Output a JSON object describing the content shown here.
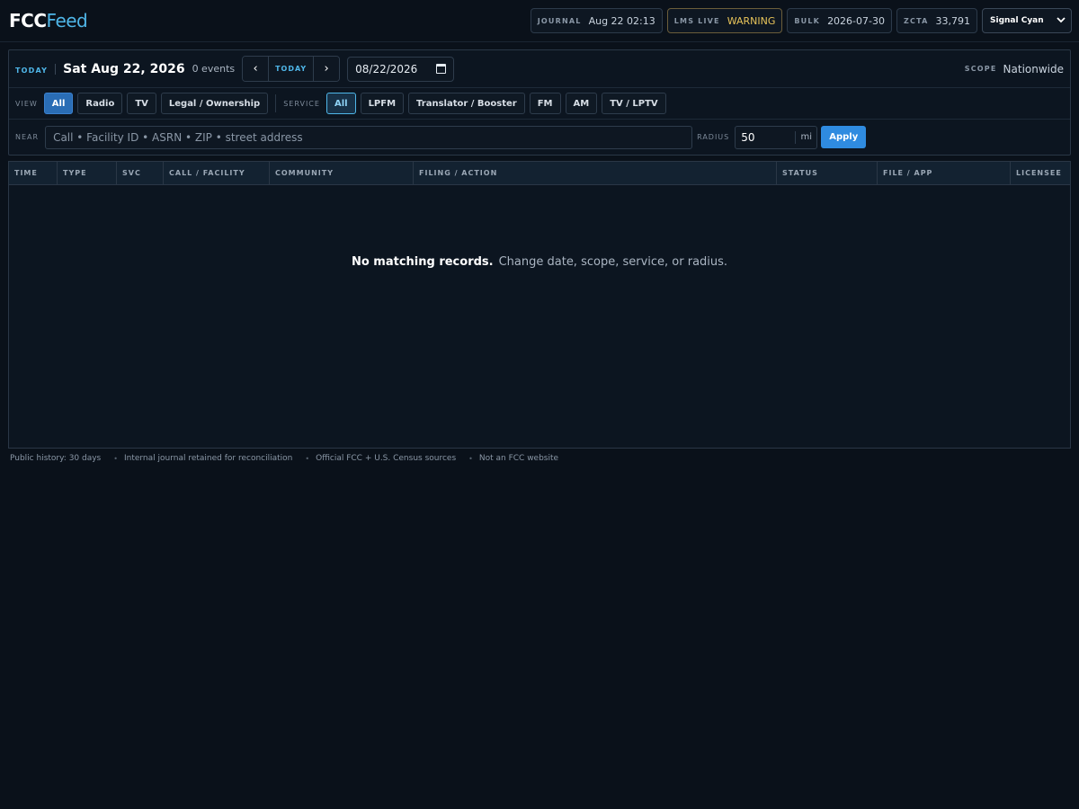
{
  "header": {
    "logo_left": "FCC",
    "logo_right": "Feed",
    "stats": [
      {
        "key": "JOURNAL",
        "value": "Aug 22 02:13"
      },
      {
        "key": "LMS LIVE",
        "value": "WARNING"
      },
      {
        "key": "BULK",
        "value": "2026-07-30"
      },
      {
        "key": "ZCTA",
        "value": "33,791"
      }
    ],
    "theme_select": "Signal Cyan"
  },
  "toolbar": {
    "today_tag": "TODAY",
    "date_title": "Sat Aug 22, 2026",
    "event_count": "0 events",
    "prev_glyph": "‹",
    "today_button": "TODAY",
    "next_glyph": "›",
    "date_value": "08/22/2026",
    "scope_label": "SCOPE",
    "scope_value": "Nationwide"
  },
  "filters": {
    "view_label": "VIEW",
    "view_options": [
      "All",
      "Radio",
      "TV",
      "Legal / Ownership"
    ],
    "view_selected": "All",
    "service_label": "SERVICE",
    "service_options": [
      "All",
      "LPFM",
      "Translator / Booster",
      "FM",
      "AM",
      "TV / LPTV"
    ],
    "service_selected": "All"
  },
  "search": {
    "near_label": "NEAR",
    "placeholder": "Call • Facility ID • ASRN • ZIP • street address",
    "radius_label": "RADIUS",
    "radius_value": "50",
    "radius_unit": "mi",
    "apply_label": "Apply"
  },
  "table": {
    "columns": [
      "TIME",
      "TYPE",
      "SVC",
      "CALL / FACILITY",
      "COMMUNITY",
      "FILING / ACTION",
      "STATUS",
      "FILE / APP",
      "LICENSEE"
    ],
    "empty_title": "No matching records.",
    "empty_hint": "Change date, scope, service, or radius."
  },
  "footer": {
    "items": [
      "Public history: 30 days",
      "Internal journal retained for reconciliation",
      "Official FCC + U.S. Census sources",
      "Not an FCC website"
    ]
  },
  "colors": {
    "accent": "#4fb6e8",
    "warning": "#e8c45a",
    "apply": "#2f8be0",
    "background": "#0a111a"
  }
}
